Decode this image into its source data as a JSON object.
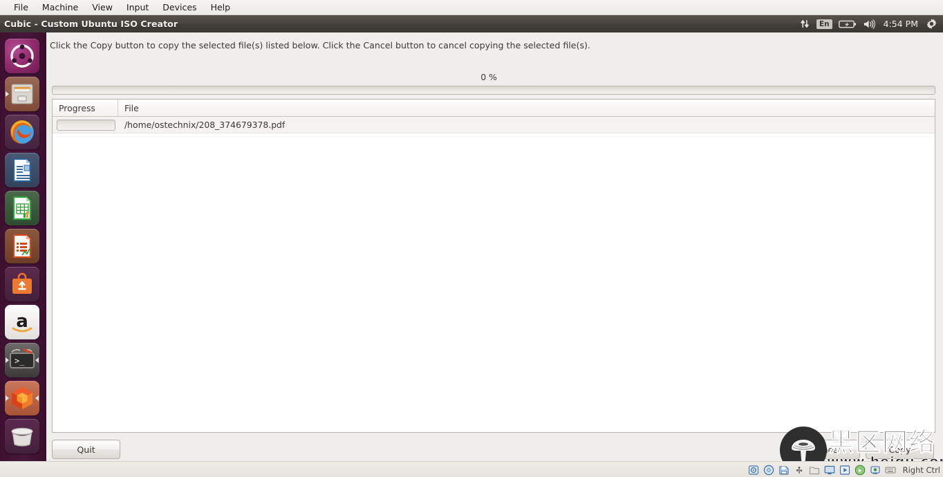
{
  "vbox": {
    "menu": [
      {
        "label": "File"
      },
      {
        "label": "Machine"
      },
      {
        "label": "View"
      },
      {
        "label": "Input"
      },
      {
        "label": "Devices"
      },
      {
        "label": "Help"
      }
    ],
    "status": {
      "host_key_label": "Right Ctrl",
      "icons": [
        {
          "name": "hard-disk-icon"
        },
        {
          "name": "optical-disk-icon"
        },
        {
          "name": "floppy-disk-icon"
        },
        {
          "name": "usb-icon"
        },
        {
          "name": "shared-folder-icon"
        },
        {
          "name": "display-icon"
        },
        {
          "name": "video-capture-icon"
        },
        {
          "name": "mouse-integration-icon"
        },
        {
          "name": "network-icon"
        },
        {
          "name": "keyboard-icon"
        }
      ]
    }
  },
  "guest": {
    "window_title": "Cubic - Custom Ubuntu ISO Creator",
    "panel": {
      "network_indicator": "network-up-down-icon",
      "keyboard_layout": "En",
      "battery_indicator": "battery-charging-icon",
      "sound_indicator": "volume-icon",
      "clock": "4:54 PM",
      "session_indicator": "gear-icon"
    },
    "launcher": {
      "items": [
        {
          "name": "launcher-item-dash",
          "label": "Ubuntu Dash",
          "icon": "ubuntu-logo-icon",
          "running": false
        },
        {
          "name": "launcher-item-files",
          "label": "Files",
          "icon": "file-manager-icon",
          "running": true
        },
        {
          "name": "launcher-item-firefox",
          "label": "Firefox Web Browser",
          "icon": "firefox-icon",
          "running": false
        },
        {
          "name": "launcher-item-writer",
          "label": "LibreOffice Writer",
          "icon": "libreoffice-writer-icon",
          "running": false
        },
        {
          "name": "launcher-item-calc",
          "label": "LibreOffice Calc",
          "icon": "libreoffice-calc-icon",
          "running": false
        },
        {
          "name": "launcher-item-impress",
          "label": "LibreOffice Impress",
          "icon": "libreoffice-impress-icon",
          "running": false
        },
        {
          "name": "launcher-item-software-center",
          "label": "Ubuntu Software Center",
          "icon": "software-center-icon",
          "running": false
        },
        {
          "name": "launcher-item-amazon",
          "label": "Amazon",
          "icon": "amazon-icon",
          "running": false
        },
        {
          "name": "launcher-item-terminal",
          "label": "Terminal",
          "icon": "terminal-icon",
          "running": true
        },
        {
          "name": "launcher-item-cubic",
          "label": "Cubic",
          "icon": "cubic-cube-icon",
          "running": true
        },
        {
          "name": "launcher-item-trash",
          "label": "Trash",
          "icon": "trash-icon",
          "running": false
        }
      ]
    }
  },
  "app": {
    "instruction": "Click the Copy button to copy the selected file(s) listed below. Click the Cancel button to cancel copying the selected file(s).",
    "progress": {
      "percent_label": "0 %",
      "percent_value": 0
    },
    "table": {
      "columns": [
        {
          "key": "progress",
          "label": "Progress"
        },
        {
          "key": "file",
          "label": "File"
        }
      ],
      "rows": [
        {
          "progress": 0,
          "file": "/home/ostechnix/208_374679378.pdf"
        }
      ]
    },
    "buttons": {
      "quit": "Quit",
      "cancel": "Cancel",
      "copy": "Copy"
    }
  },
  "watermark": {
    "logo": "mushroom-logo-icon",
    "text_cn": "黑区网络",
    "url": "www.heiqu.com"
  },
  "colors": {
    "launcher_bg": "#3d1030",
    "titlebar_bg": "#4a4540",
    "window_bg": "#f0eeec",
    "accent": "#e0752a"
  }
}
